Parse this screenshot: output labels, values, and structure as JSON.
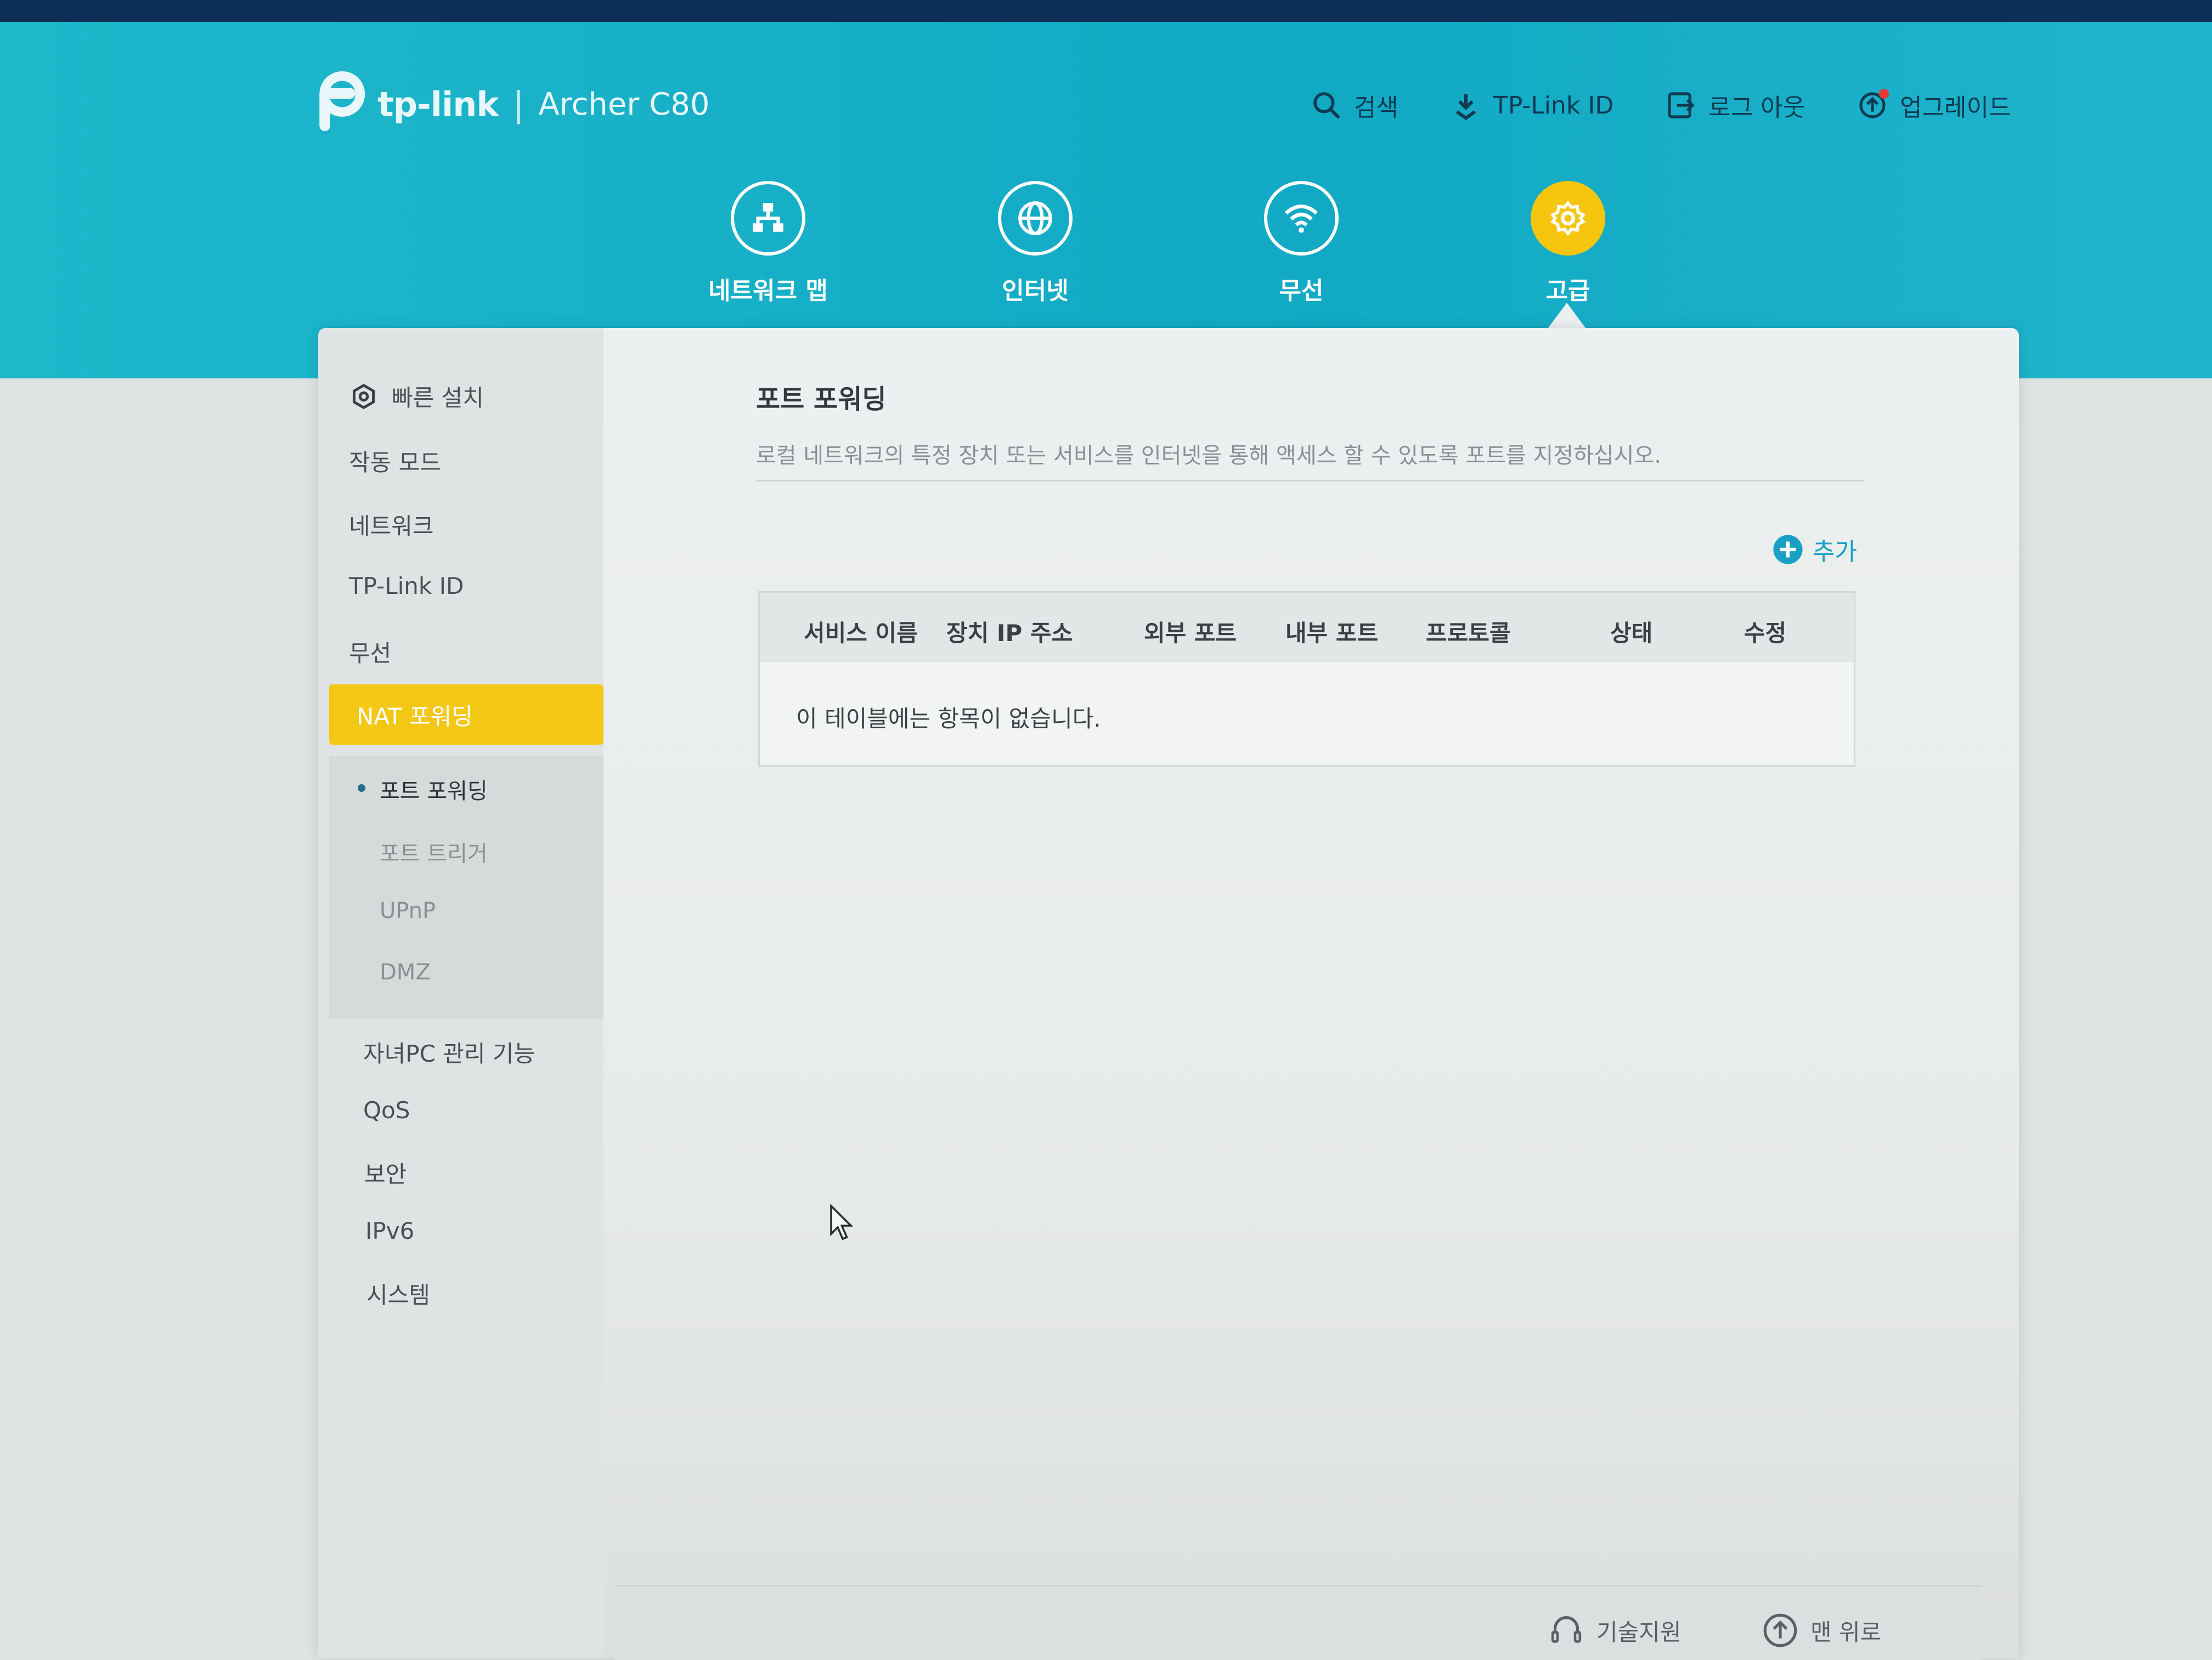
{
  "header": {
    "brand": "tp-link",
    "separator": "|",
    "model": "Archer C80",
    "links": {
      "search": "검색",
      "tplink_id": "TP-Link ID",
      "logout": "로그 아웃",
      "upgrade": "업그레이드"
    }
  },
  "main_nav": [
    {
      "label": "네트워크 맵",
      "icon": "network-map-icon"
    },
    {
      "label": "인터넷",
      "icon": "globe-icon"
    },
    {
      "label": "무선",
      "icon": "wifi-icon"
    },
    {
      "label": "고급",
      "icon": "gear-icon",
      "active": true
    }
  ],
  "sidebar": {
    "items": [
      {
        "label": "빠른 설치",
        "icon": "quick-setup-icon"
      },
      {
        "label": "작동 모드"
      },
      {
        "label": "네트워크"
      },
      {
        "label": "TP-Link ID"
      },
      {
        "label": "무선"
      },
      {
        "label": "NAT 포워딩",
        "active": true
      },
      {
        "label": "자녀PC 관리 기능"
      },
      {
        "label": "QoS"
      },
      {
        "label": "보안"
      },
      {
        "label": "IPv6"
      },
      {
        "label": "시스템"
      }
    ],
    "subitems": [
      {
        "label": "포트 포워딩",
        "current": true
      },
      {
        "label": "포트 트리거"
      },
      {
        "label": "UPnP"
      },
      {
        "label": "DMZ"
      }
    ]
  },
  "content": {
    "title": "포트 포워딩",
    "description": "로컬 네트워크의 특정 장치 또는 서비스를 인터넷을 통해 액세스 할 수 있도록 포트를 지정하십시오.",
    "add_label": "추가",
    "table": {
      "columns": [
        "서비스 이름",
        "장치 IP 주소",
        "외부 포트",
        "내부 포트",
        "프로토콜",
        "상태",
        "수정"
      ],
      "empty_message": "이 테이블에는 항목이 없습니다."
    }
  },
  "footer": {
    "support": "기술지원",
    "back_to_top": "맨 위로"
  },
  "colors": {
    "header": "#11a9c4",
    "accent": "#f3c716",
    "link": "#1aa0c5"
  }
}
